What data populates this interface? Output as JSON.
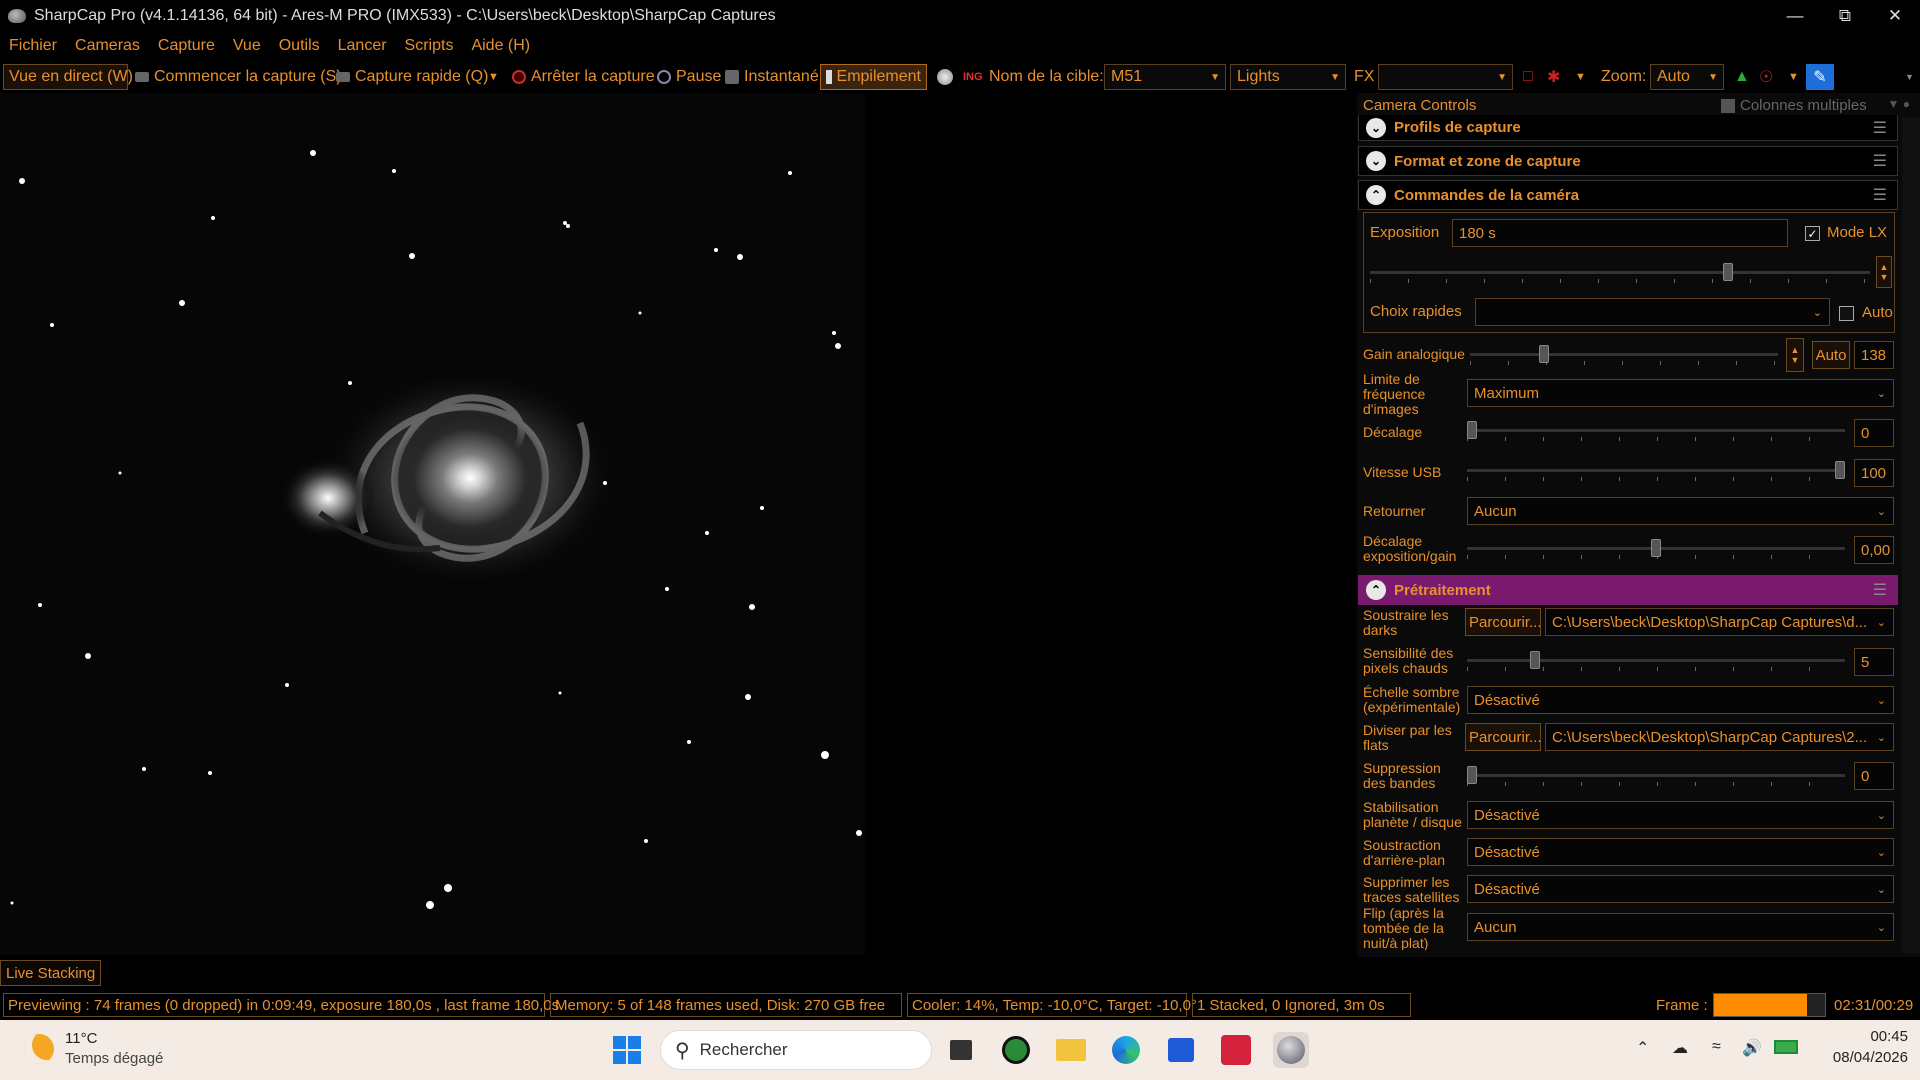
{
  "window": {
    "title": "SharpCap Pro (v4.1.14136, 64 bit) - Ares-M PRO (IMX533) - C:\\Users\\beck\\Desktop\\SharpCap Captures"
  },
  "menu": [
    "Fichier",
    "Cameras",
    "Capture",
    "Vue",
    "Outils",
    "Lancer",
    "Scripts",
    "Aide (H)"
  ],
  "toolbar": {
    "live_view": "Vue en direct (W)",
    "start_capture": "Commencer la capture (S)",
    "quick_capture": "Capture rapide (Q)",
    "stop_capture": "Arrêter la capture",
    "pause": "Pause",
    "snapshot": "Instantané",
    "stacking": "Empilement",
    "target_label": "Nom de la cible:",
    "target_value": "M51",
    "frame_type": "Lights",
    "fx_label": "FX",
    "fx_value": "",
    "zoom_label": "Zoom:",
    "zoom_value": "Auto"
  },
  "panel": {
    "title": "Camera Controls",
    "multi_columns": "Colonnes multiples",
    "sections": {
      "capture_profiles": "Profils de capture",
      "format_area": "Format et zone de capture",
      "camera_controls": "Commandes de la caméra",
      "preprocessing": "Prétraitement"
    },
    "exposure": {
      "label": "Exposition",
      "value": "180 s",
      "lx_label": "Mode LX",
      "lx_checked": true,
      "slider": 0.72
    },
    "quick_choice": {
      "label": "Choix rapides",
      "value": "",
      "auto_label": "Auto"
    },
    "gain": {
      "label": "Gain analogique",
      "auto_label": "Auto",
      "value": "138",
      "slider": 0.23
    },
    "frame_rate": {
      "label": "Limite de fréquence d'images",
      "value": "Maximum"
    },
    "offset": {
      "label": "Décalage",
      "value": "0",
      "slider": 0.0
    },
    "usb_speed": {
      "label": "Vitesse USB",
      "value": "100",
      "slider": 1.0
    },
    "flip": {
      "label": "Retourner",
      "value": "Aucun"
    },
    "exp_gain_offset": {
      "label": "Décalage exposition/gain",
      "value": "0,00",
      "slider": 0.5
    },
    "darks": {
      "label": "Soustraire les darks",
      "browse": "Parcourir...",
      "path": "C:\\Users\\beck\\Desktop\\SharpCap Captures\\d..."
    },
    "hot_pixels": {
      "label": "Sensibilité des pixels chauds",
      "value": "5",
      "slider": 0.17
    },
    "dark_scale": {
      "label": "Échelle sombre (expérimentale)",
      "value": "Désactivé"
    },
    "flats": {
      "label": "Diviser par les flats",
      "browse": "Parcourir...",
      "path": "C:\\Users\\beck\\Desktop\\SharpCap Captures\\2..."
    },
    "banding": {
      "label": "Suppression des bandes",
      "value": "0",
      "slider": 0.0
    },
    "stabilization": {
      "label": "Stabilisation planète / disque",
      "value": "Désactivé"
    },
    "bg_subtraction": {
      "label": "Soustraction d'arrière-plan",
      "value": "Désactivé"
    },
    "satellite": {
      "label": "Supprimer les traces satellites",
      "value": "Désactivé"
    },
    "flip_after": {
      "label": "Flip (après la tombée de la nuit/à plat)",
      "value": "Aucun"
    }
  },
  "live_stacking_tab": "Live Stacking",
  "status": {
    "preview": "Previewing : 74 frames (0 dropped) in 0:09:49, exposure 180,0s , last frame 180,0s",
    "memory": "Memory: 5 of 148 frames used, Disk: 270 GB free",
    "cooler": "Cooler: 14%, Temp: -10,0°C, Target: -10,0°",
    "stacked": "1 Stacked, 0 Ignored, 3m 0s",
    "frame_label": "Frame :",
    "frame_time": "02:31/00:29",
    "frame_progress": 0.84
  },
  "taskbar": {
    "weather_temp": "11°C",
    "weather_desc": "Temps dégagé",
    "search": "Rechercher",
    "time": "00:45",
    "date": "08/04/2026"
  },
  "colors": {
    "accent": "#e8902c",
    "preprocessing": "#7a1a6e",
    "progress": "#ff8c00"
  }
}
